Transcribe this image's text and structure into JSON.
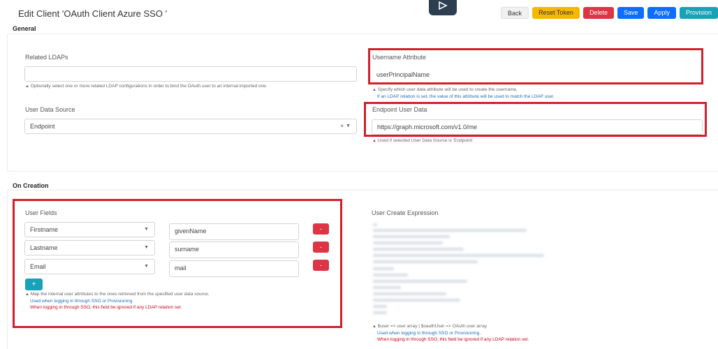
{
  "header": {
    "title": "Edit Client 'OAuth Client Azure SSO '",
    "buttons": {
      "back": "Back",
      "reset_token": "Reset Token",
      "delete": "Delete",
      "save": "Save",
      "apply": "Apply",
      "provision": "Provision"
    }
  },
  "general": {
    "heading": "General",
    "related_ldaps": {
      "label": "Related LDAPs",
      "value": "",
      "help": "Optionally select one or more related LDAP configurations in order to bind the OAuth user to an internal imported one."
    },
    "user_data_source": {
      "label": "User Data Source",
      "value": "Endpoint",
      "clear": "×",
      "arrow": "▼"
    },
    "username_attribute": {
      "label": "Username Attribute",
      "value": "userPrincipalName",
      "help_line1": "Specify which user data attribute will be used to create the username.",
      "help_line2": "If an LDAP relation is set, the value of this attribute will be used to match the LDAP user."
    },
    "endpoint_user_data": {
      "label": "Endpoint User Data",
      "value": "https://graph.microsoft.com/v1.0/me",
      "help": "Used if selected User Data Source is 'Endpoint'."
    }
  },
  "on_creation": {
    "heading": "On Creation",
    "user_fields": {
      "label": "User Fields",
      "rows": [
        {
          "attribute": "Firstname",
          "mapping": "givenName",
          "remove": "-"
        },
        {
          "attribute": "Lastname",
          "mapping": "surname",
          "remove": "-"
        },
        {
          "attribute": "Email",
          "mapping": "mail",
          "remove": "-"
        }
      ],
      "add": "+",
      "help_line1": "Map the internal user attributes to the ones retrieved from the specified user data source.",
      "help_line2": "Used when logging in through SSO or Provisioning.",
      "help_line3": "When logging in through SSO, this field be ignored if any LDAP relation set."
    },
    "user_create_expression": {
      "label": "User Create Expression",
      "help_line1": "$user => user array | $oauthUser => OAuth user array",
      "help_line2": "Used when logging in through SSO or Provisioning.",
      "help_line3": "When logging in through SSO, this field be ignored if any LDAP relation set."
    }
  },
  "icons": {
    "caret": "▲",
    "arrow": "▼"
  },
  "colors": {
    "highlight": "#d31f2b",
    "primary": "#0d6efd",
    "danger": "#dc3545",
    "warning": "#f5b800",
    "info": "#17a2b8"
  }
}
